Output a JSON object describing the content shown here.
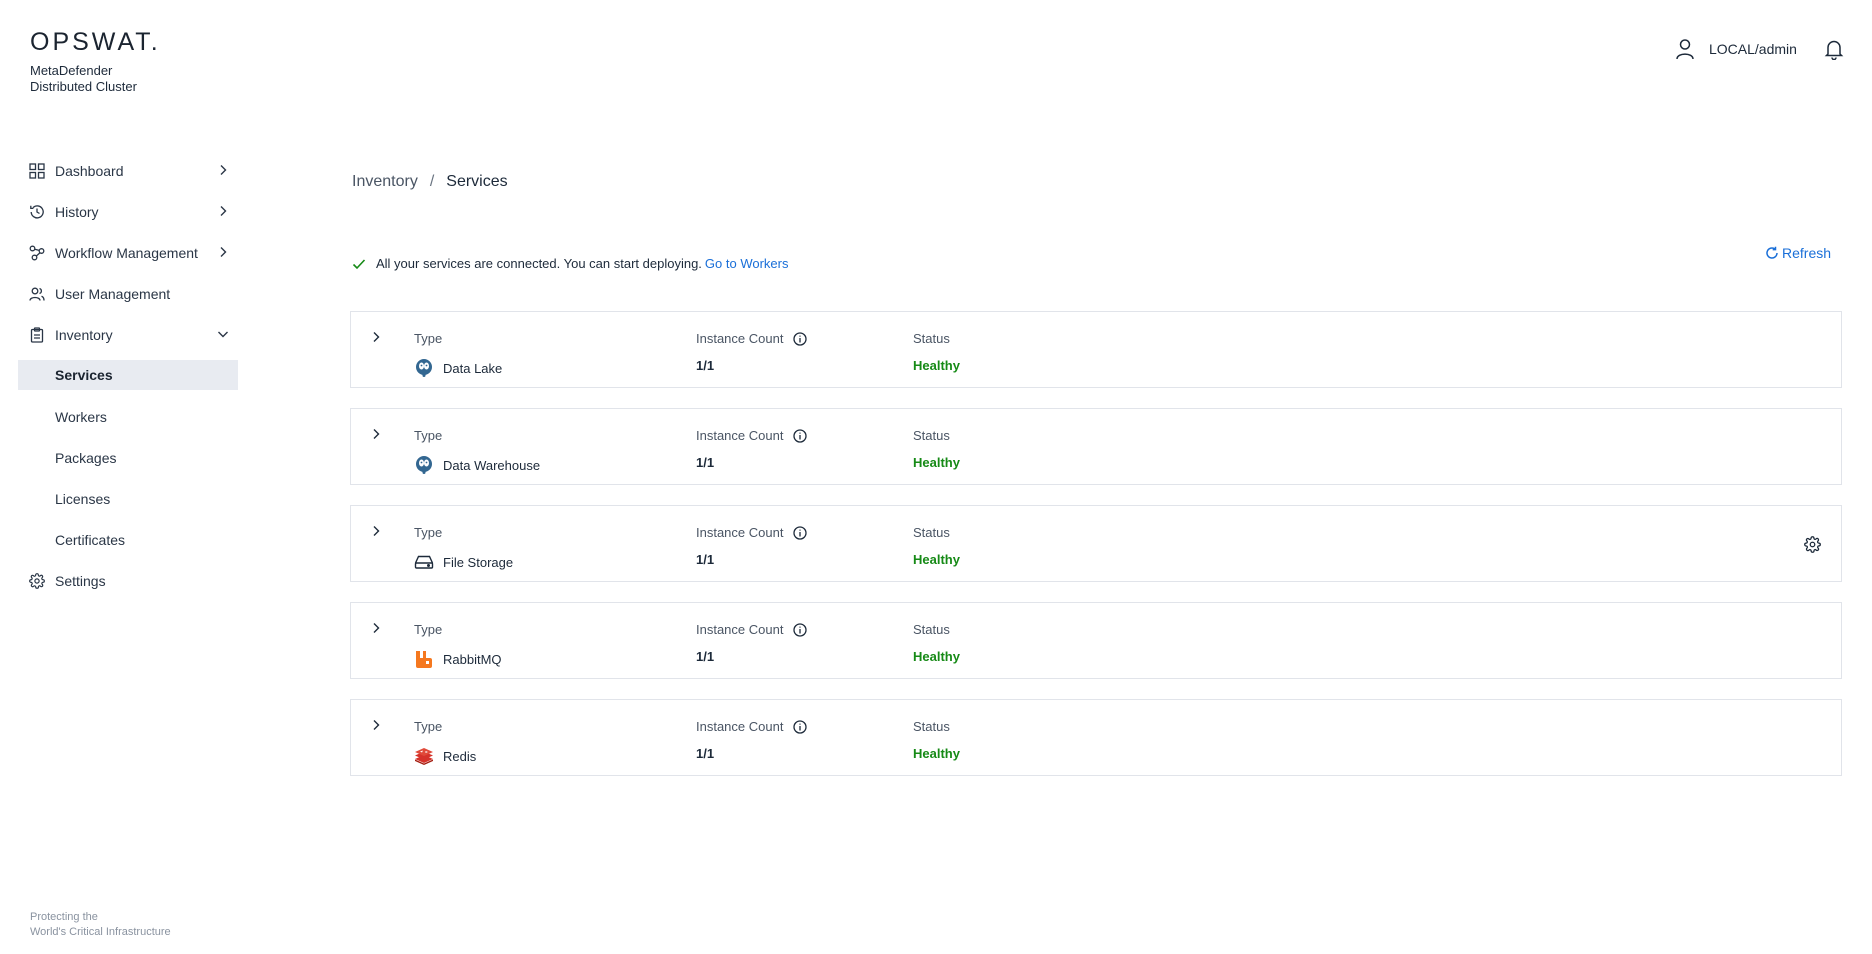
{
  "brand": {
    "logo": "OPSWAT.",
    "product_line1": "MetaDefender",
    "product_line2": "Distributed Cluster",
    "tagline_line1": "Protecting the",
    "tagline_line2": "World's Critical Infrastructure"
  },
  "sidebar": {
    "items": [
      {
        "label": "Dashboard",
        "icon": "dashboard-grid-icon"
      },
      {
        "label": "History",
        "icon": "history-icon"
      },
      {
        "label": "Workflow Management",
        "icon": "workflow-icon"
      },
      {
        "label": "User Management",
        "icon": "users-icon"
      },
      {
        "label": "Inventory",
        "icon": "clipboard-icon"
      },
      {
        "label": "Settings",
        "icon": "gear-icon"
      }
    ],
    "inventory_children": [
      {
        "label": "Services",
        "active": true
      },
      {
        "label": "Workers"
      },
      {
        "label": "Packages"
      },
      {
        "label": "Licenses"
      },
      {
        "label": "Certificates"
      }
    ]
  },
  "header": {
    "user": "LOCAL/admin"
  },
  "breadcrumb": {
    "parent": "Inventory",
    "separator": "/",
    "current": "Services"
  },
  "notice": {
    "message": "All your services are connected. You can start deploying.",
    "link": "Go to Workers"
  },
  "refresh_label": "Refresh",
  "columns": {
    "type": "Type",
    "count": "Instance Count",
    "status": "Status"
  },
  "services": [
    {
      "type": "Data Lake",
      "count": "1/1",
      "status": "Healthy",
      "icon": "postgresql-icon"
    },
    {
      "type": "Data Warehouse",
      "count": "1/1",
      "status": "Healthy",
      "icon": "postgresql-icon"
    },
    {
      "type": "File Storage",
      "count": "1/1",
      "status": "Healthy",
      "icon": "hard-drive-icon"
    },
    {
      "type": "RabbitMQ",
      "count": "1/1",
      "status": "Healthy",
      "icon": "rabbitmq-icon"
    },
    {
      "type": "Redis",
      "count": "1/1",
      "status": "Healthy",
      "icon": "redis-icon"
    }
  ],
  "colors": {
    "accent": "#1a6fd8",
    "healthy": "#168a16",
    "active_bg": "#e8ebf1",
    "rabbit": "#f5781f",
    "redis": "#d6322a"
  }
}
